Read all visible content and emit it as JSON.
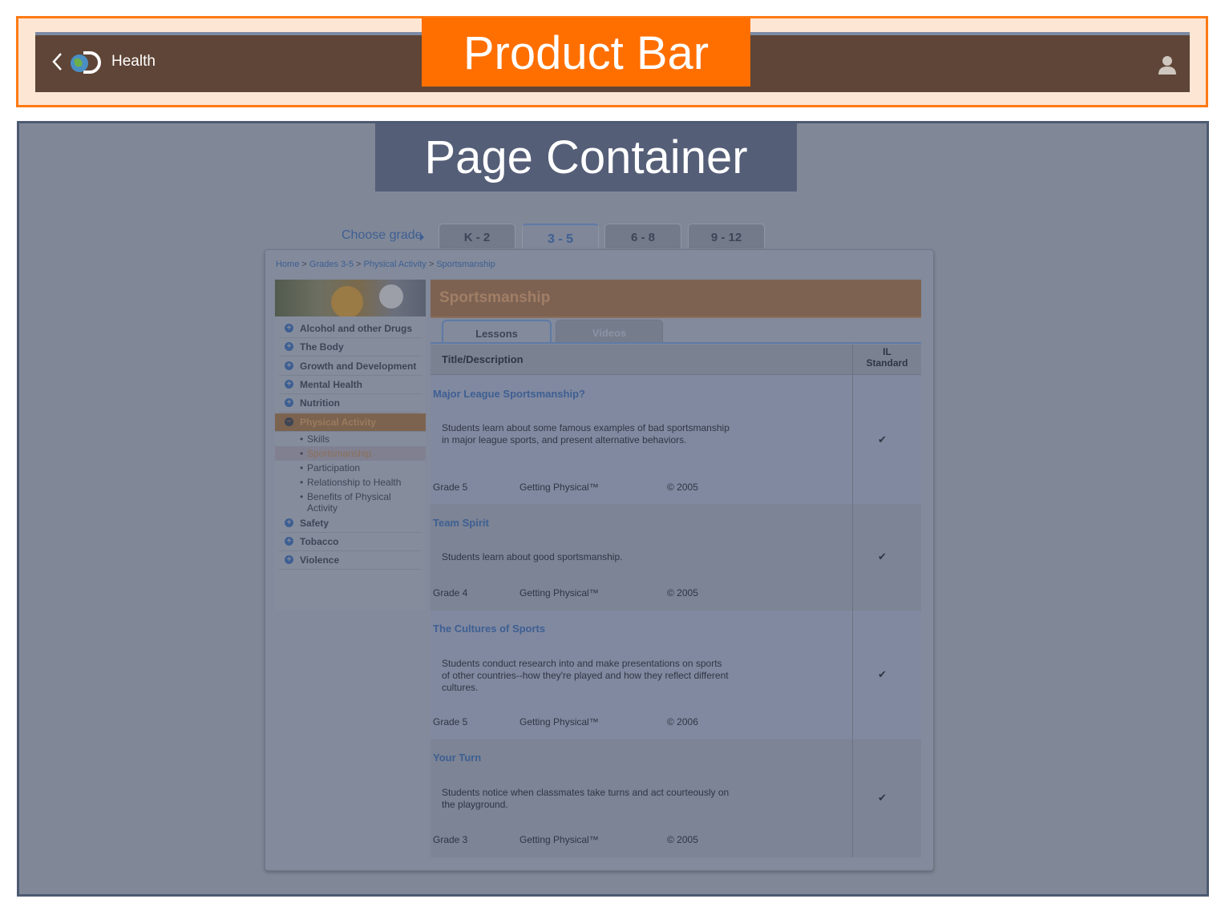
{
  "annotations": {
    "product_bar_label": "Product Bar",
    "page_container_label": "Page Container"
  },
  "product_bar": {
    "back_icon": "chevron-left-icon",
    "logo_icon": "globe-d-logo-icon",
    "title": "Health",
    "user_icon": "user-icon"
  },
  "grade_nav": {
    "choose_label": "Choose grade",
    "tabs": [
      "K - 2",
      "3 - 5",
      "6 - 8",
      "9 - 12"
    ],
    "active_tab": "3 - 5"
  },
  "breadcrumb": {
    "items": [
      "Home",
      "Grades 3-5",
      "Physical Activity",
      "Sportsmanship"
    ],
    "separator": ">"
  },
  "sidebar": {
    "categories_top": [
      "Alcohol and other Drugs",
      "The Body",
      "Growth and Development",
      "Mental Health",
      "Nutrition"
    ],
    "active_category": "Physical Activity",
    "subitems": [
      "Skills",
      "Sportsmanship",
      "Participation",
      "Relationship to Health",
      "Benefits of Physical Activity"
    ],
    "active_subitem": "Sportsmanship",
    "categories_bottom": [
      "Safety",
      "Tobacco",
      "Violence"
    ]
  },
  "content": {
    "heading": "Sportsmanship",
    "tabs": [
      "Lessons",
      "Videos"
    ],
    "active_tab": "Lessons",
    "columns": {
      "title": "Title/Description",
      "standard_line1": "IL",
      "standard_line2": "Standard"
    },
    "rows": [
      {
        "title": "Major League Sportsmanship?",
        "description": "Students learn about some famous examples of bad sportsmanship in major league sports, and present alternative behaviors.",
        "grade": "Grade 5",
        "series": "Getting Physical™",
        "year": "© 2005",
        "standard_check": "✔"
      },
      {
        "title": "Team Spirit",
        "description": "Students learn about good sportsmanship.",
        "grade": "Grade 4",
        "series": "Getting Physical™",
        "year": "© 2005",
        "standard_check": "✔"
      },
      {
        "title": "The Cultures of Sports",
        "description": "Students conduct research into and make presentations on sports of other countries--how they're played and how they reflect different cultures.",
        "grade": "Grade 5",
        "series": "Getting Physical™",
        "year": "© 2006",
        "standard_check": "✔"
      },
      {
        "title": "Your Turn",
        "description": "Students notice when classmates take turns and act courteously on the playground.",
        "grade": "Grade 3",
        "series": "Getting Physical™",
        "year": "© 2005",
        "standard_check": "✔"
      }
    ]
  },
  "colors": {
    "annotation_orange": "#ff6f00",
    "annotation_slate": "#545e77",
    "product_bar_brown": "#5f4537",
    "link_blue": "#3e5f92"
  }
}
